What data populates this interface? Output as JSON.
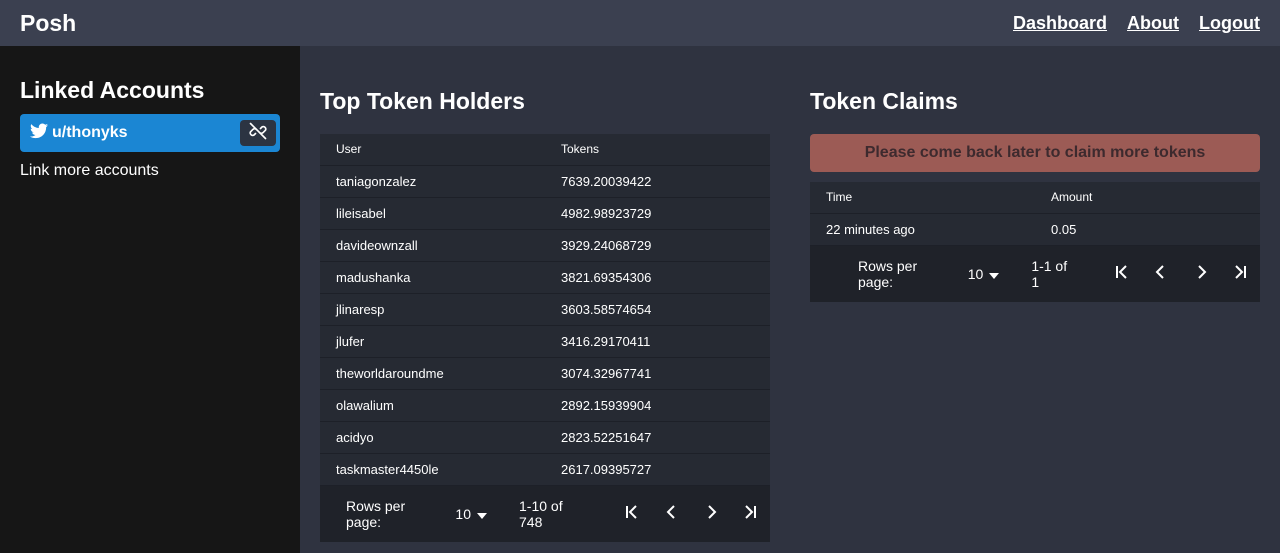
{
  "header": {
    "brand": "Posh",
    "nav": [
      "Dashboard",
      "About",
      "Logout"
    ]
  },
  "sidebar": {
    "title": "Linked Accounts",
    "account": {
      "icon": "twitter-icon",
      "name": "u/thonyks",
      "unlink_icon": "unlink-icon"
    },
    "link_more": "Link more accounts"
  },
  "holders": {
    "title": "Top Token Holders",
    "columns": [
      "User",
      "Tokens"
    ],
    "rows": [
      [
        "taniagonzalez",
        "7639.20039422"
      ],
      [
        "lileisabel",
        "4982.98923729"
      ],
      [
        "davideownzall",
        "3929.24068729"
      ],
      [
        "madushanka",
        "3821.69354306"
      ],
      [
        "jlinaresp",
        "3603.58574654"
      ],
      [
        "jlufer",
        "3416.29170411"
      ],
      [
        "theworldaroundme",
        "3074.32967741"
      ],
      [
        "olawalium",
        "2892.15939904"
      ],
      [
        "acidyo",
        "2823.52251647"
      ],
      [
        "taskmaster4450le",
        "2617.09395727"
      ]
    ],
    "pager": {
      "rows_label": "Rows per page:",
      "rows_value": "10",
      "range": "1-10 of 748"
    }
  },
  "claims": {
    "title": "Token Claims",
    "banner": "Please come back later to claim more tokens",
    "banner_color": "#9c5b55",
    "columns": [
      "Time",
      "Amount"
    ],
    "rows": [
      [
        "22 minutes ago",
        "0.05"
      ]
    ],
    "pager": {
      "rows_label": "Rows per page:",
      "rows_value": "10",
      "range": "1-1 of 1"
    }
  },
  "colors": {
    "topbar": "#3b4050",
    "sidebar": "#161616",
    "background": "#2f3340",
    "accent": "#1b86d3"
  }
}
